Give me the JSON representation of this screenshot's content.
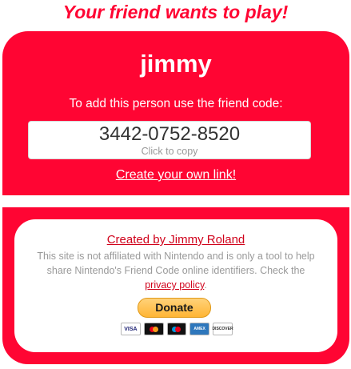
{
  "headline": "Your friend wants to play!",
  "profile": {
    "name": "jimmy",
    "instruction": "To add this person use the friend code:",
    "friend_code": "3442-0752-8520",
    "copy_hint": "Click to copy",
    "create_link": "Create your own link!"
  },
  "footer": {
    "credit": "Created by Jimmy Roland",
    "disclaimer_before": "This site is not affiliated with Nintendo and is only a tool to help share Nintendo's Friend Code online identifiers. Check the ",
    "privacy_link": "privacy policy",
    "disclaimer_after": ".",
    "donate_label": "Donate",
    "payment_cards": {
      "visa": "VISA",
      "amex": "AMERICAN EXPRESS",
      "discover": "DISCOVER"
    }
  },
  "colors": {
    "brand_red": "#ff0533",
    "link_red": "#d0021b"
  }
}
